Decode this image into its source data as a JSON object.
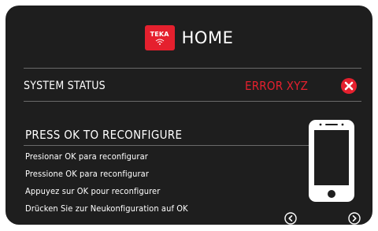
{
  "header": {
    "logo_text": "TEKA",
    "title": "HOME"
  },
  "status": {
    "label": "SYSTEM STATUS",
    "value": "ERROR XYZ",
    "error_color": "#e5202e"
  },
  "instructions": {
    "heading": "PRESS OK TO RECONFIGURE",
    "lines": [
      "Presionar OK para reconfigurar",
      "Pressione OK para reconfigurar",
      "Appuyez sur OK pour reconfigurer",
      "Drücken Sie zur Neukonfiguration auf OK"
    ]
  },
  "icons": {
    "error": "close-circle-icon",
    "phone": "smartphone-icon",
    "prev": "chevron-left-circle-icon",
    "next": "chevron-right-circle-icon"
  },
  "colors": {
    "background": "#1e1e1e",
    "accent": "#e5202e",
    "text": "#ffffff"
  }
}
